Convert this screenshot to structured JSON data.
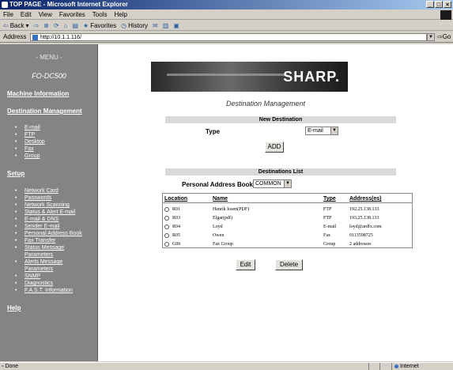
{
  "window": {
    "title": "TOP PAGE - Microsoft Internet Explorer",
    "controls": [
      "_",
      "□",
      "×"
    ]
  },
  "menubar": [
    "File",
    "Edit",
    "View",
    "Favorites",
    "Tools",
    "Help"
  ],
  "toolbar": {
    "back": "Back",
    "favorites": "Favorites",
    "history": "History"
  },
  "address": {
    "label": "Address",
    "url": "http://10.1.1.116/",
    "go": "Go"
  },
  "sidebar": {
    "menu_title": "- MENU -",
    "model": "FO-DC500",
    "machine_info": "Machine Information",
    "dest_mgmt": "Destination Management",
    "dest_items": [
      "E-mail",
      "FTP",
      "Desktop",
      "Fax",
      "Group"
    ],
    "setup": "Setup",
    "setup_items": [
      "Network Card",
      "Passwords",
      "Network Scanning",
      "Status & Alert E-mail",
      "E-mail & DNS",
      "Sender E-mail",
      "Personal Address Book",
      "Fax Transfer",
      "Status Message",
      "Parameters",
      "Alerts Message",
      "Parameters",
      "SNMP",
      "Diagnostics",
      "F.A.S.T. Information"
    ],
    "help": "Help"
  },
  "main": {
    "logo": "SHARP.",
    "heading": "Destination Management",
    "new_dest": {
      "header": "New Destination",
      "type_label": "Type",
      "type_value": "E-mail",
      "add_button": "ADD"
    },
    "dest_list": {
      "header": "Destinations List",
      "pab_label": "Personal Address Book",
      "pab_value": "COMMON",
      "columns": [
        "Location",
        "Name",
        "Type",
        "Address(es)"
      ],
      "rows": [
        {
          "location": "R01",
          "name": "Henrik Iosen(PDF)",
          "type": "FTP",
          "address": "192.25.138.133"
        },
        {
          "location": "R03",
          "name": "Elgar(pdf)",
          "type": "FTP",
          "address": "193.25.138.133"
        },
        {
          "location": "R04",
          "name": "Loyd",
          "type": "E-mail",
          "address": "loyd@ardfx.com"
        },
        {
          "location": "R05",
          "name": "Owen",
          "type": "Fax",
          "address": "0113598725"
        },
        {
          "location": "G06",
          "name": "Fax Group",
          "type": "Group",
          "address": "2 addresses"
        }
      ],
      "edit_button": "Edit",
      "delete_button": "Delete"
    }
  },
  "status": {
    "text": "Done",
    "zone": "Internet"
  }
}
